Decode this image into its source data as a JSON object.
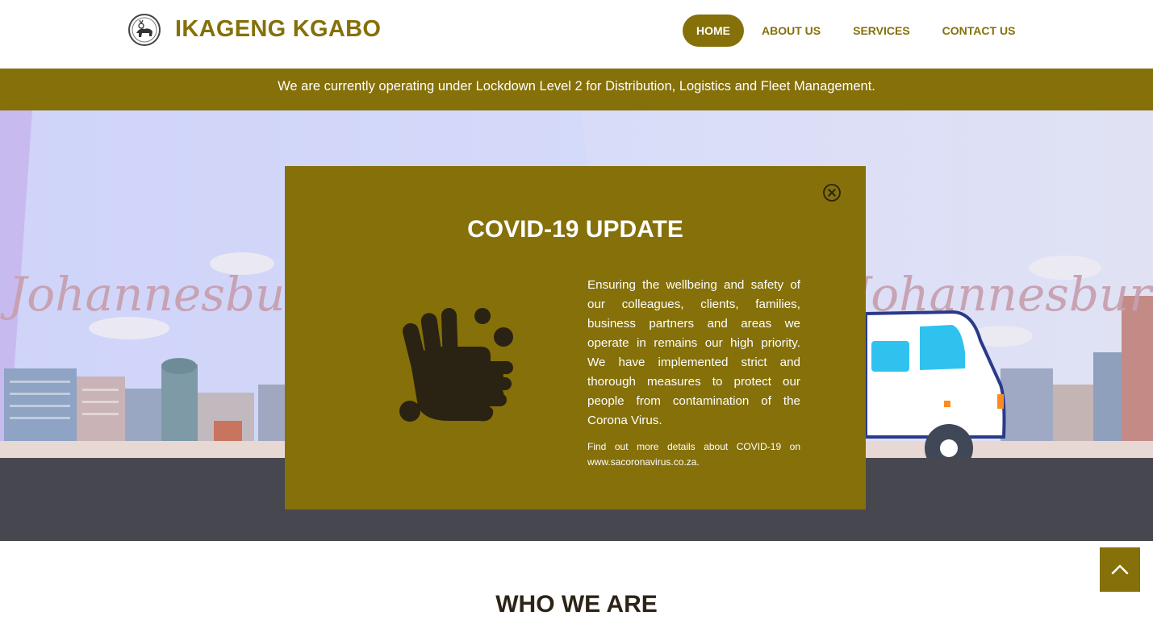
{
  "header": {
    "brand": "IKAGENG KGABO",
    "nav": [
      {
        "label": "HOME",
        "active": true
      },
      {
        "label": "ABOUT US"
      },
      {
        "label": "SERVICES"
      },
      {
        "label": "CONTACT US"
      }
    ]
  },
  "notice": {
    "text": "We are currently operating under Lockdown Level 2 for Distribution, Logistics and Fleet Management."
  },
  "hero": {
    "city_text": "Johannesburg"
  },
  "modal": {
    "title": "COVID-19 UPDATE",
    "body": "Ensuring the wellbeing and safety of our colleagues, clients, families, business partners and areas we operate in remains our high priority. We have implemented strict and thorough measures to protect our people from contamination of the Corona Virus.",
    "small": "Find out more details about COVID-19 on www.sacoronavirus.co.za."
  },
  "section": {
    "who_title": "WHO WE ARE"
  },
  "colors": {
    "accent": "#857009",
    "hero_bottom": "#47474f",
    "hand": "#2a2212"
  },
  "icons": {
    "close": "close-circle-icon",
    "hand": "hand-washing-icon",
    "to_top": "chevron-up-icon"
  }
}
